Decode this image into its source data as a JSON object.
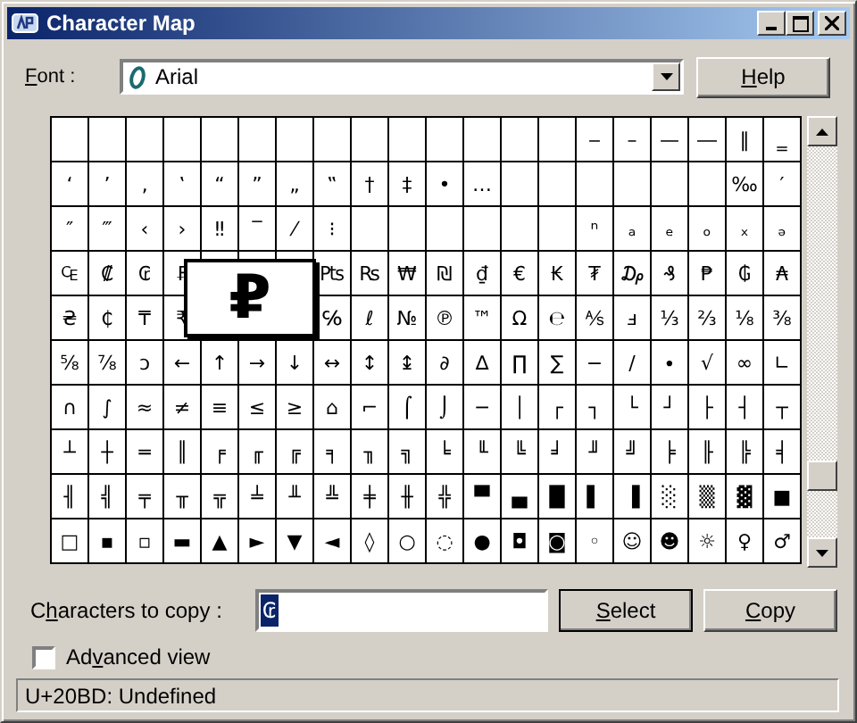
{
  "window": {
    "title": "Character Map"
  },
  "font": {
    "label_parts": {
      "key": "F",
      "post": "ont :"
    },
    "value": "Arial"
  },
  "help_button": {
    "key": "H",
    "post": "elp"
  },
  "grid": {
    "rows": [
      [
        null,
        null,
        null,
        null,
        null,
        null,
        null,
        null,
        null,
        null,
        null,
        null,
        null,
        null,
        "‒",
        "–",
        "—",
        "―",
        "‖",
        "‗"
      ],
      [
        "‘",
        "’",
        "‚",
        "‛",
        "“",
        "”",
        "„",
        "‟",
        "†",
        "‡",
        "•",
        "…",
        null,
        null,
        null,
        null,
        null,
        null,
        "‰",
        "′"
      ],
      [
        "″",
        "‴",
        "‹",
        "›",
        "‼",
        "‾",
        "⁄",
        "⁝",
        null,
        null,
        null,
        null,
        null,
        null,
        "ⁿ",
        "ₐ",
        "ₑ",
        "ₒ",
        "ₓ",
        "ₔ"
      ],
      [
        "₠",
        "₡",
        "₢",
        "₣",
        null,
        null,
        null,
        "₧",
        "₨",
        "₩",
        "₪",
        "₫",
        "€",
        "₭",
        "₮",
        "₯",
        "₰",
        "₱",
        "₲",
        "₳"
      ],
      [
        "₴",
        "₵",
        "₸",
        "₹",
        null,
        null,
        null,
        "℅",
        "ℓ",
        "№",
        "℗",
        "™",
        "Ω",
        "℮",
        "⅍",
        "ⅎ",
        "⅓",
        "⅔",
        "⅛",
        "⅜"
      ],
      [
        "⅝",
        "⅞",
        "ↄ",
        "←",
        "↑",
        "→",
        "↓",
        "↔",
        "↕",
        "↨",
        "∂",
        "∆",
        "∏",
        "∑",
        "−",
        "∕",
        "∙",
        "√",
        "∞",
        "∟"
      ],
      [
        "∩",
        "∫",
        "≈",
        "≠",
        "≡",
        "≤",
        "≥",
        "⌂",
        "⌐",
        "⌠",
        "⌡",
        "─",
        "│",
        "┌",
        "┐",
        "└",
        "┘",
        "├",
        "┤",
        "┬"
      ],
      [
        "┴",
        "┼",
        "═",
        "║",
        "╒",
        "╓",
        "╔",
        "╕",
        "╖",
        "╗",
        "╘",
        "╙",
        "╚",
        "╛",
        "╜",
        "╝",
        "╞",
        "╟",
        "╠",
        "╡"
      ],
      [
        "╢",
        "╣",
        "╤",
        "╥",
        "╦",
        "╧",
        "╨",
        "╩",
        "╪",
        "╫",
        "╬",
        "▀",
        "▄",
        "█",
        "▌",
        "▐",
        "░",
        "▒",
        "▓",
        "■"
      ],
      [
        "□",
        "▪",
        "▫",
        "▬",
        "▲",
        "►",
        "▼",
        "◄",
        "◊",
        "○",
        "◌",
        "●",
        "◘",
        "◙",
        "◦",
        "☺",
        "☻",
        "☼",
        "♀",
        "♂"
      ]
    ],
    "magnified": "₽"
  },
  "copy": {
    "label_parts": {
      "pre": "C",
      "key": "h",
      "post": "aracters to copy :"
    },
    "value": "₢"
  },
  "select_button": {
    "key": "S",
    "post": "elect"
  },
  "copy_button": {
    "key": "C",
    "post": "opy"
  },
  "advanced_view": {
    "label_parts": {
      "pre": "Ad",
      "key": "v",
      "post": "anced view"
    },
    "checked": false
  },
  "status_bar": "U+20BD: Undefined"
}
